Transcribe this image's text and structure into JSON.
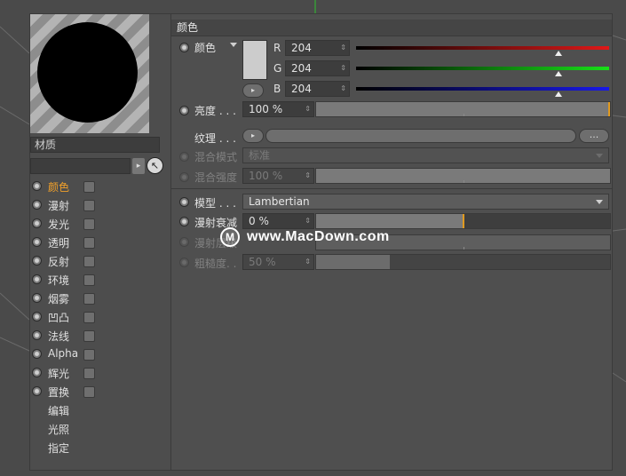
{
  "left_panel": {
    "material_name": "材质",
    "channels": [
      {
        "label": "颜色",
        "active": true
      },
      {
        "label": "漫射",
        "active": false
      },
      {
        "label": "发光",
        "active": false
      },
      {
        "label": "透明",
        "active": false
      },
      {
        "label": "反射",
        "active": false
      },
      {
        "label": "环境",
        "active": false
      },
      {
        "label": "烟雾",
        "active": false
      },
      {
        "label": "凹凸",
        "active": false
      },
      {
        "label": "法线",
        "active": false
      },
      {
        "label": "Alpha",
        "active": false
      },
      {
        "label": "辉光",
        "active": false
      },
      {
        "label": "置换",
        "active": false
      }
    ],
    "extra_items": [
      "编辑",
      "光照",
      "指定"
    ]
  },
  "right_panel": {
    "section_title": "颜色",
    "color": {
      "label": "颜色",
      "swatch": "#cccccc",
      "r": {
        "letter": "R",
        "value": "204"
      },
      "g": {
        "letter": "G",
        "value": "204"
      },
      "b": {
        "letter": "B",
        "value": "204"
      }
    },
    "brightness": {
      "label": "亮度 . . .",
      "value": "100 %"
    },
    "texture": {
      "label": "纹理 . . .",
      "more": "..."
    },
    "blend_mode": {
      "label": "混合模式",
      "value": "标准"
    },
    "blend_strength": {
      "label": "混合强度",
      "value": "100 %"
    },
    "model": {
      "label": "模型 . . .",
      "value": "Lambertian"
    },
    "diffuse_falloff": {
      "label": "漫射衰减",
      "value": "0 %",
      "fill_fraction": 0.5
    },
    "diffuse_level": {
      "label": "漫射层级"
    },
    "roughness": {
      "label": "粗糙度. .",
      "value": "50 %",
      "fill_fraction": 0.25
    }
  },
  "watermark": {
    "text": "www.MacDown.com",
    "logo": "M"
  },
  "colors": {
    "accent": "#f0a02a",
    "red": "#e01818",
    "green": "#18e018",
    "blue": "#1818e8",
    "panel": "#4d4d4d"
  }
}
